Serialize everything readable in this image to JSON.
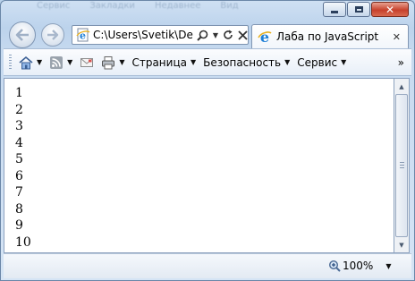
{
  "titlebar": {
    "ghost_items": [
      "Сервис",
      "Закладки",
      "Недавнее",
      "Вид"
    ]
  },
  "address": {
    "url": "C:\\Users\\Svetik\\Des"
  },
  "tab": {
    "title": "Лаба по JavaScript"
  },
  "command_bar": {
    "items": [
      {
        "label": "Страница"
      },
      {
        "label": "Безопасность"
      },
      {
        "label": "Сервис"
      }
    ]
  },
  "content": {
    "lines": [
      "1",
      "2",
      "3",
      "4",
      "5",
      "6",
      "7",
      "8",
      "9",
      "10"
    ]
  },
  "status": {
    "zoom": "100%"
  },
  "colors": {
    "frame": "#bcd3ec",
    "close_button": "#c7412c",
    "ie_blue": "#1e7fd6"
  }
}
